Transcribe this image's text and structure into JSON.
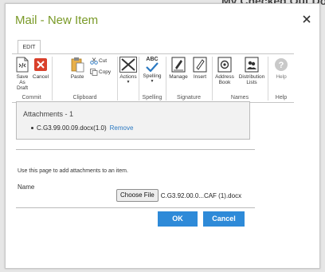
{
  "background": {
    "partial_text": "My Checked Out Do"
  },
  "dialog": {
    "title": "Mail - New Item",
    "title_color": "#7a9a28"
  },
  "ribbon": {
    "tab": "EDIT",
    "groups": {
      "commit": {
        "label": "Commit",
        "save_as_draft_line1": "Save As",
        "save_as_draft_line2": "Draft",
        "cancel": "Cancel"
      },
      "clipboard": {
        "label": "Clipboard",
        "paste": "Paste",
        "cut": "Cut",
        "copy": "Copy"
      },
      "actions": {
        "label": "Actions"
      },
      "spelling": {
        "label": "Spelling",
        "spelling": "Spelling",
        "abc": "ABC"
      },
      "signature": {
        "label": "Signature",
        "manage": "Manage",
        "insert": "Insert"
      },
      "names": {
        "label": "Names",
        "address_book_line1": "Address",
        "address_book_line2": "Book",
        "distribution_lists_line1": "Distribution",
        "distribution_lists_line2": "Lists"
      },
      "help": {
        "label": "Help",
        "help": "Help"
      }
    }
  },
  "attachments": {
    "header": "Attachments - 1",
    "items": [
      {
        "name": "C.G3.99.00.09.docx(1.0)",
        "remove": "Remove"
      }
    ]
  },
  "upload": {
    "info": "Use this page to add attachments to an item.",
    "name_label": "Name",
    "choose_file": "Choose File",
    "file_name": "C.G3.92.00.0...CAF (1).docx"
  },
  "buttons": {
    "ok": "OK",
    "cancel": "Cancel",
    "accent": "#2e8ad8"
  }
}
